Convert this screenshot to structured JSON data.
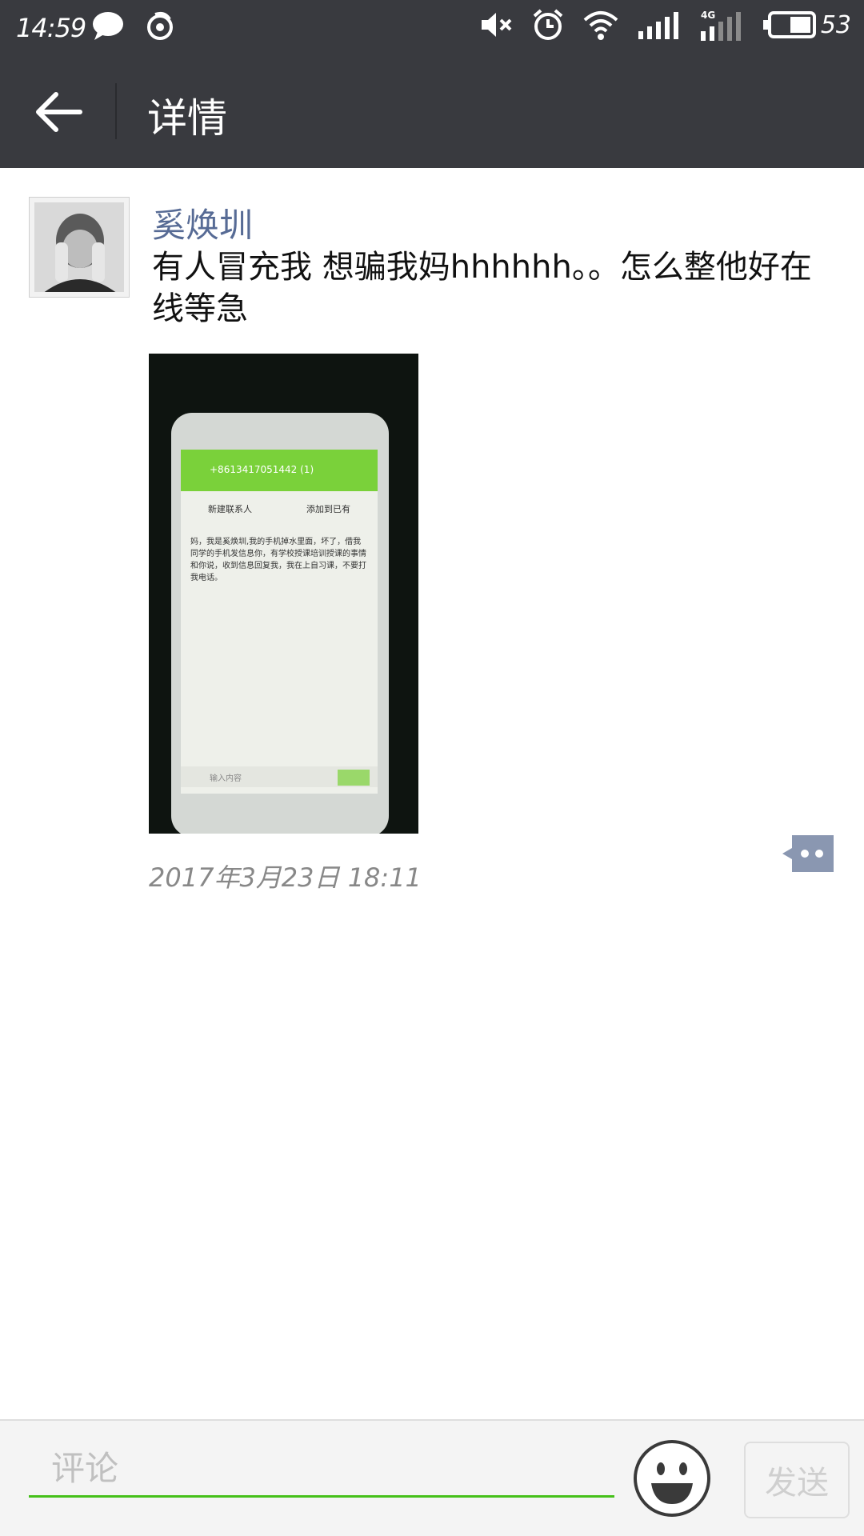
{
  "status_bar": {
    "time": "14:59",
    "battery_level": "53",
    "network_type": "4G",
    "left_icons": [
      "chat-bubble-icon",
      "weibo-icon"
    ],
    "right_icons": [
      "muted-speaker-icon",
      "alarm-icon",
      "wifi-icon",
      "signal-icon",
      "signal-4g-icon",
      "battery-icon"
    ]
  },
  "navbar": {
    "title": "详情",
    "back_icon": "back-arrow-icon",
    "background": "#393a3f"
  },
  "post": {
    "author": "奚焕圳",
    "text": "有人冒充我 想骗我妈hhhhhh。。怎么整他好在线等急",
    "timestamp": "2017年3月23日   18:11",
    "photo": {
      "phone_number": "+8613417051442 (1)",
      "action_new_contact": "新建联系人",
      "action_add_existing": "添加到已有",
      "message": "妈，我是奚焕圳,我的手机掉水里面，坏了，借我同学的手机发信息你，有学校授课培训授课的事情和你说，收到信息回复我，我在上自习课，不要打我电话。",
      "input_placeholder": "输入内容"
    },
    "author_color": "#576b95"
  },
  "comment_bar": {
    "placeholder": "评论",
    "send_label": "发送",
    "accent": "#45c01a"
  }
}
